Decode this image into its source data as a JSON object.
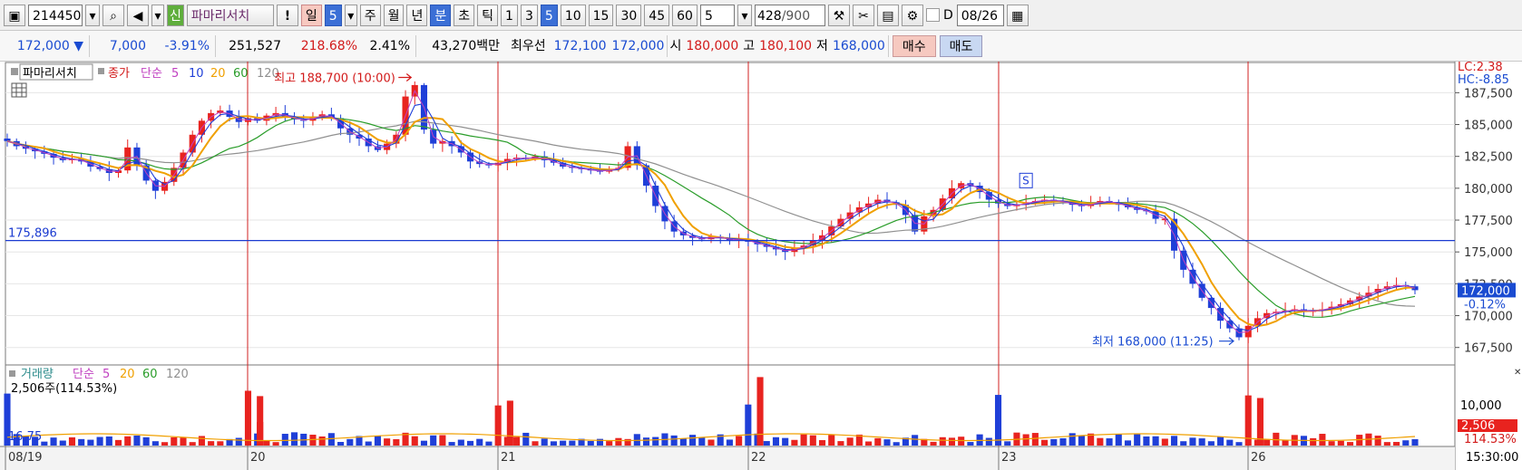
{
  "toolbar": {
    "stock_code": "214450",
    "credit_badge": "신",
    "stock_name": "파마리서치",
    "warn": "!",
    "period_day": "일",
    "period_num": "5",
    "periods": [
      "주",
      "월",
      "년",
      "분",
      "초",
      "틱"
    ],
    "minutes": [
      "1",
      "3",
      "5",
      "10",
      "15",
      "30",
      "45",
      "60"
    ],
    "interval": "5",
    "count": "428",
    "count_total": "/900",
    "date_label": "D",
    "date": "08/26"
  },
  "quote": {
    "price": "172,000",
    "arrow": "▼",
    "change": "7,000",
    "change_pct": "-3.91%",
    "volume": "251,527",
    "vol_ratio": "218.68%",
    "turnover": "2.41%",
    "amount": "43,270백만",
    "best_label": "최우선",
    "best_ask": "172,100",
    "best_bid": "172,000",
    "open_label": "시",
    "open": "180,000",
    "high_label": "고",
    "high": "180,100",
    "low_label": "저",
    "low": "168,000",
    "buy": "매수",
    "sell": "매도"
  },
  "chart_data": [
    {
      "type": "candlestick",
      "panel": "price",
      "legend": {
        "name": "파마리서치",
        "close": "종가",
        "ma_type": "단순",
        "periods": [
          "5",
          "10",
          "20",
          "60",
          "120"
        ]
      },
      "colors": {
        "up": "#e8231f",
        "down": "#1f3fd8",
        "ma5": "#c040c0",
        "ma10": "#1f3fd8",
        "ma20": "#f0a000",
        "ma60": "#2a9d2a",
        "ma120": "#909090"
      },
      "x_labels": [
        "08/19",
        "20",
        "21",
        "22",
        "23",
        "26"
      ],
      "y_ticks": [
        167500,
        170000,
        172500,
        175000,
        177500,
        180000,
        182500,
        185000,
        187500
      ],
      "ylim": [
        166200,
        189800
      ],
      "series_close": [
        183700,
        183300,
        183100,
        182900,
        182700,
        182400,
        182200,
        182300,
        182100,
        181700,
        181500,
        181200,
        181400,
        183200,
        181800,
        180600,
        179800,
        180500,
        181600,
        182800,
        184200,
        185300,
        185900,
        186100,
        185600,
        185200,
        185500,
        185300,
        185700,
        185900,
        185600,
        185400,
        185300,
        185600,
        185800,
        185500,
        184700,
        184200,
        183900,
        183300,
        183000,
        183500,
        184200,
        187200,
        188100,
        184600,
        183500,
        183700,
        183300,
        182800,
        182100,
        181900,
        181800,
        182000,
        182300,
        182400,
        182300,
        182500,
        182200,
        182000,
        181700,
        181600,
        181500,
        181400,
        181300,
        181500,
        181600,
        183300,
        181800,
        180200,
        178600,
        177400,
        176600,
        176300,
        176100,
        176000,
        176200,
        176100,
        175900,
        176000,
        175800,
        175600,
        175400,
        175200,
        175000,
        175300,
        175500,
        175900,
        176300,
        177000,
        177600,
        178100,
        178500,
        178800,
        179100,
        178900,
        178700,
        177900,
        176600,
        177800,
        178300,
        179200,
        180000,
        180400,
        180200,
        179700,
        179100,
        178800,
        178600,
        178700,
        178900,
        179000,
        179100,
        179000,
        178900,
        178700,
        178600,
        178800,
        179000,
        178900,
        178700,
        178500,
        178300,
        178200,
        177600,
        177600,
        175100,
        173600,
        172500,
        171400,
        170600,
        169600,
        169000,
        168300,
        169200,
        169800,
        170200,
        170300,
        170400,
        170500,
        170300,
        170400,
        170500,
        170700,
        170900,
        171200,
        171500,
        171800,
        172100,
        172300,
        172400,
        172300,
        172000
      ],
      "annotations": [
        {
          "text": "최고 188,700 (10:00)",
          "value": 188700,
          "color": "#d21a1a"
        },
        {
          "text": "최저 168,000 (11:25)",
          "value": 168000,
          "color": "#1a4bd1"
        }
      ],
      "reference_line": {
        "value": 175896,
        "label": "175,896",
        "color": "#1a3ad0"
      },
      "price_tag": {
        "value": "172,000",
        "pct": "-0.12%"
      },
      "lc_hc": {
        "lc": "LC:2.38",
        "hc": "HC:-8.85"
      }
    },
    {
      "type": "bar",
      "panel": "volume",
      "legend": {
        "name": "거래량",
        "ma_type": "단순",
        "periods": [
          "5",
          "20",
          "60",
          "120"
        ],
        "value": "2,506주(114.53%)"
      },
      "y_ticks_labels": [
        "10,000"
      ],
      "left_value": "16,75",
      "current_tag": {
        "value": "2,506",
        "pct": "114.53%"
      },
      "time_label": "15:30:00",
      "volume_peaks": [
        {
          "day_index": 1,
          "value": 6200
        },
        {
          "day_index": 1,
          "value": 13000
        },
        {
          "day_index": 2,
          "value": 11800
        },
        {
          "day_index": 3,
          "value": 18000
        },
        {
          "day_index": 5,
          "value": 12500
        }
      ]
    }
  ]
}
